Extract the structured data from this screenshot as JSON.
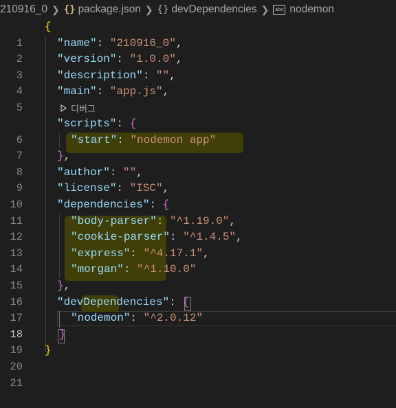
{
  "breadcrumb": {
    "folder": "210916_0",
    "file": "package.json",
    "object": "devDependencies",
    "property": "nodemon",
    "file_icon": "braces-icon",
    "object_icon": "braces-icon",
    "property_icon": "string-icon"
  },
  "codelens": {
    "label": "디버그",
    "icon": "play-icon"
  },
  "editor": {
    "active_line": 18,
    "line_numbers": [
      "1",
      "2",
      "3",
      "4",
      "5",
      "6",
      "7",
      "8",
      "9",
      "10",
      "11",
      "12",
      "13",
      "14",
      "15",
      "16",
      "17",
      "18",
      "19",
      "20",
      "21"
    ],
    "lines": {
      "l1": {
        "brace": "{"
      },
      "l2": {
        "key": "\"name\"",
        "colon": ": ",
        "value": "\"210916_0\"",
        "comma": ","
      },
      "l3": {
        "key": "\"version\"",
        "colon": ": ",
        "value": "\"1.0.0\"",
        "comma": ","
      },
      "l4": {
        "key": "\"description\"",
        "colon": ": ",
        "value": "\"\"",
        "comma": ","
      },
      "l5": {
        "key": "\"main\"",
        "colon": ": ",
        "value": "\"app.js\"",
        "comma": ","
      },
      "l6": {
        "key": "\"scripts\"",
        "colon": ": ",
        "brace": "{"
      },
      "l7": {
        "key": "\"start\"",
        "colon": ": ",
        "value": "\"nodemon app\""
      },
      "l8": {
        "brace": "}",
        "comma": ","
      },
      "l9": {
        "key": "\"author\"",
        "colon": ": ",
        "value": "\"\"",
        "comma": ","
      },
      "l10": {
        "key": "\"license\"",
        "colon": ": ",
        "value": "\"ISC\"",
        "comma": ","
      },
      "l11": {
        "key": "\"dependencies\"",
        "colon": ": ",
        "brace": "{"
      },
      "l12": {
        "key": "\"body-parser\"",
        "colon": ": ",
        "value": "\"^1.19.0\"",
        "comma": ","
      },
      "l13": {
        "key": "\"cookie-parser\"",
        "colon": ": ",
        "value": "\"^1.4.5\"",
        "comma": ","
      },
      "l14": {
        "key": "\"express\"",
        "colon": ": ",
        "value": "\"^4.17.1\"",
        "comma": ","
      },
      "l15": {
        "key": "\"morgan\"",
        "colon": ": ",
        "value": "\"^1.10.0\""
      },
      "l16": {
        "brace": "}",
        "comma": ","
      },
      "l17": {
        "key": "\"devDependencies\"",
        "colon": ": ",
        "brace": "{"
      },
      "l18": {
        "key": "\"nodemon\"",
        "colon": ": ",
        "value": "\"^2.0.12\""
      },
      "l19": {
        "brace": "}"
      },
      "l20": {
        "brace": "}"
      }
    }
  },
  "colors": {
    "background": "#1e1e1e",
    "key": "#9cdcfe",
    "string": "#ce9178",
    "punctuation": "#d4d4d4",
    "bracket_level_1": "#ffd700",
    "bracket_level_2": "#da70d6",
    "bracket_level_3": "#179fff",
    "highlight": "#3f3f07"
  }
}
